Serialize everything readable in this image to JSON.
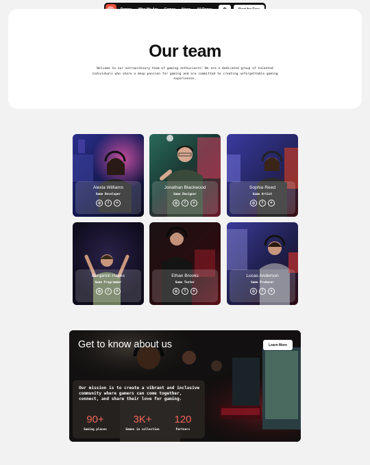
{
  "nav": {
    "items": [
      "Demos",
      "Who We Are",
      "Games",
      "News",
      "All Pages"
    ],
    "cta_label": "Start for Free",
    "logo_icon": "target-logo-icon",
    "cart_icon": "shopping-bag-icon"
  },
  "hero": {
    "title": "Our team",
    "description": "Welcome to our extraordinary team of gaming enthusiasts! We are a dedicated group of talented individuals who share a deep passion for gaming and are committed to creating unforgettable gaming experiences."
  },
  "team": [
    {
      "name": "Alexia Williams",
      "role": "Game Developer"
    },
    {
      "name": "Jonathan Blackwood",
      "role": "Game Designer"
    },
    {
      "name": "Sophia Reed",
      "role": "Game Artist"
    },
    {
      "name": "Benjamin Hayes",
      "role": "Game Programmer"
    },
    {
      "name": "Ethan Brooks",
      "role": "Game Tester"
    },
    {
      "name": "Lucas Anderson",
      "role": "Game Producer"
    }
  ],
  "socials": [
    "instagram-icon",
    "facebook-icon",
    "twitter-icon"
  ],
  "about": {
    "title": "Get to know about us",
    "button_label": "Learn More",
    "mission": "Our mission is to create a vibrant and inclusive community where gamers can come together, connect, and share their love for gaming.",
    "stats": [
      {
        "value": "90+",
        "label": "Gaming places"
      },
      {
        "value": "3K+",
        "label": "Games in collection"
      },
      {
        "value": "120",
        "label": "Partners"
      }
    ]
  },
  "colors": {
    "accent": "#f0665a",
    "logo": "#e8503a",
    "nav_bg": "#111111"
  }
}
